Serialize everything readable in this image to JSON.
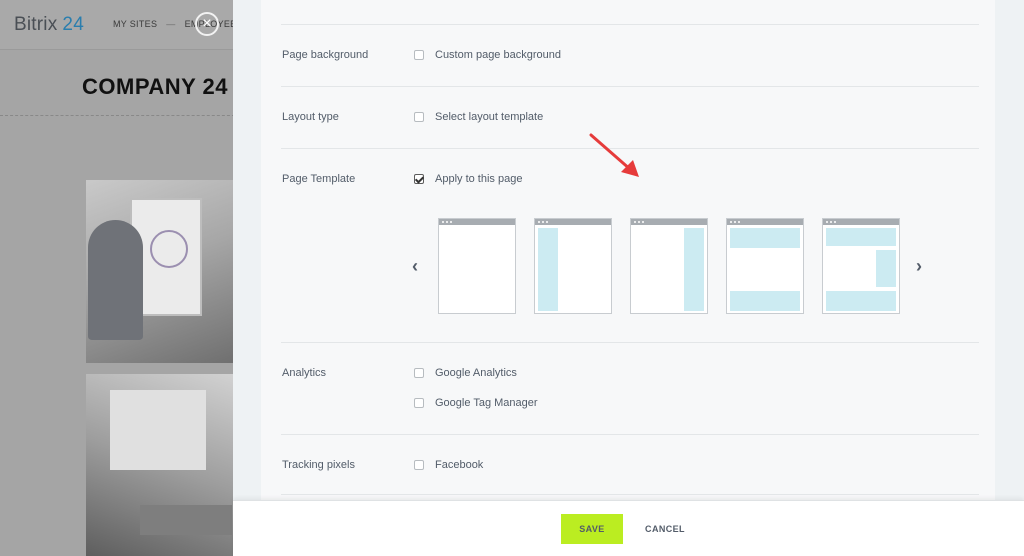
{
  "background": {
    "logo_text": "Bitrix",
    "logo_num": "24",
    "nav": [
      "MY SITES",
      "EMPLOYEES PAGE"
    ],
    "nav_sep": "—",
    "company_title": "COMPANY 24"
  },
  "close_icon_glyph": "×",
  "settings": {
    "page_background": {
      "label": "Page background",
      "option": "Custom page background",
      "checked": false
    },
    "layout_type": {
      "label": "Layout type",
      "option": "Select layout template",
      "checked": false
    },
    "page_template": {
      "label": "Page Template",
      "option": "Apply to this page",
      "checked": true,
      "templates": [
        "empty",
        "left-sidebar",
        "right-sidebar",
        "header-footer",
        "header-footer-right-sidebar"
      ],
      "prev_glyph": "‹",
      "next_glyph": "›"
    },
    "analytics": {
      "label": "Analytics",
      "options": [
        {
          "label": "Google Analytics",
          "checked": false
        },
        {
          "label": "Google Tag Manager",
          "checked": false
        }
      ]
    },
    "tracking_pixels": {
      "label": "Tracking pixels",
      "option": "Facebook",
      "checked": false
    }
  },
  "footer": {
    "save_label": "SAVE",
    "cancel_label": "CANCEL"
  },
  "colors": {
    "accent_save": "#bbed21",
    "template_block": "#ccebf2",
    "annotation_arrow": "#e63b3b"
  }
}
